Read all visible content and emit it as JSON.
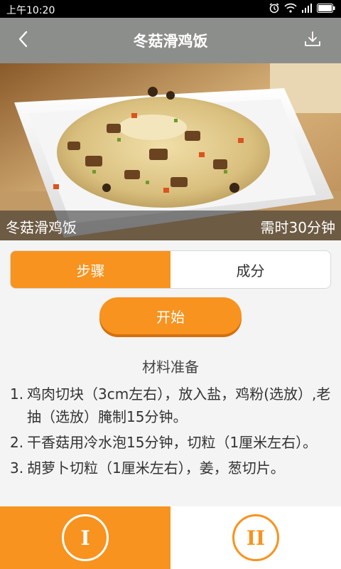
{
  "status_bar": {
    "time": "上午10:20"
  },
  "header": {
    "title": "冬菇滑鸡饭"
  },
  "hero": {
    "dish_name": "冬菇滑鸡饭",
    "duration": "需时30分钟"
  },
  "tabs": [
    {
      "label": "步骤",
      "active": true
    },
    {
      "label": "成分",
      "active": false
    }
  ],
  "start_label": "开始",
  "steps_section": {
    "title": "材料准备",
    "steps": [
      {
        "num": "1.",
        "text": "鸡肉切块（3cm左右），放入盐，鸡粉(选放）,老抽（选放）腌制15分钟。"
      },
      {
        "num": "2.",
        "text": "干香菇用冷水泡15分钟，切粒（1厘米左右）。"
      },
      {
        "num": "3.",
        "text": "胡萝卜切粒（1厘米左右），姜，葱切片。"
      }
    ]
  },
  "bottom_tabs": [
    {
      "label": "I",
      "active": true
    },
    {
      "label": "II",
      "active": false
    }
  ],
  "colors": {
    "accent": "#f7931e",
    "app_bar": "#8c8e8b",
    "background": "#f4f4f4"
  },
  "icons": {
    "back": "chevron-left-icon",
    "download": "download-icon",
    "alarm": "alarm-icon",
    "wifi": "wifi-icon",
    "signal": "signal-icon",
    "battery": "battery-icon"
  }
}
